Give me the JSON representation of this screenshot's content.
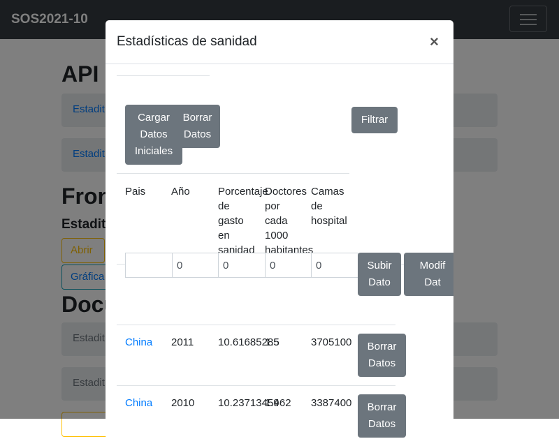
{
  "navbar": {
    "brand": "SOS2021-10"
  },
  "background": {
    "heading_api": "API",
    "api_items": [
      "Estadit",
      "Estadit"
    ],
    "heading_front": "Fron",
    "front_subheading": "Estadit",
    "abrir_button": "Abrir",
    "grafica_button": "Gráfica",
    "heading_docs": "Docu",
    "doc_items": [
      "Estadit",
      "Estadit"
    ]
  },
  "modal": {
    "title": "Estadísticas de sanidad",
    "close_label": "×",
    "buttons": {
      "load_initial": "Cargar\nDatos\nIniciales",
      "delete_data": "Borrar\nDatos",
      "filter": "Filtrar",
      "upload": "Subir\nDato",
      "modify": "Modif\nDat"
    },
    "table": {
      "headers": [
        "Pais",
        "Año",
        "Porcentaje\nde\ngasto\nen\nsanidad",
        "Doctores\npor\ncada\n1000\nhabitantes",
        "Camas\nde\nhospital"
      ],
      "input_values": [
        "",
        "0",
        "0",
        "0",
        "0"
      ],
      "rows": [
        {
          "country": "China",
          "year": "2011",
          "percentage": "10.61685285",
          "doctors": "1.5",
          "beds": "3705100",
          "delete_label": "Borrar\nDatos"
        },
        {
          "country": "China",
          "year": "2010",
          "percentage": "10.23713459",
          "doctors": "1.462",
          "beds": "3387400",
          "delete_label": "Borrar\nDatos"
        }
      ]
    }
  }
}
